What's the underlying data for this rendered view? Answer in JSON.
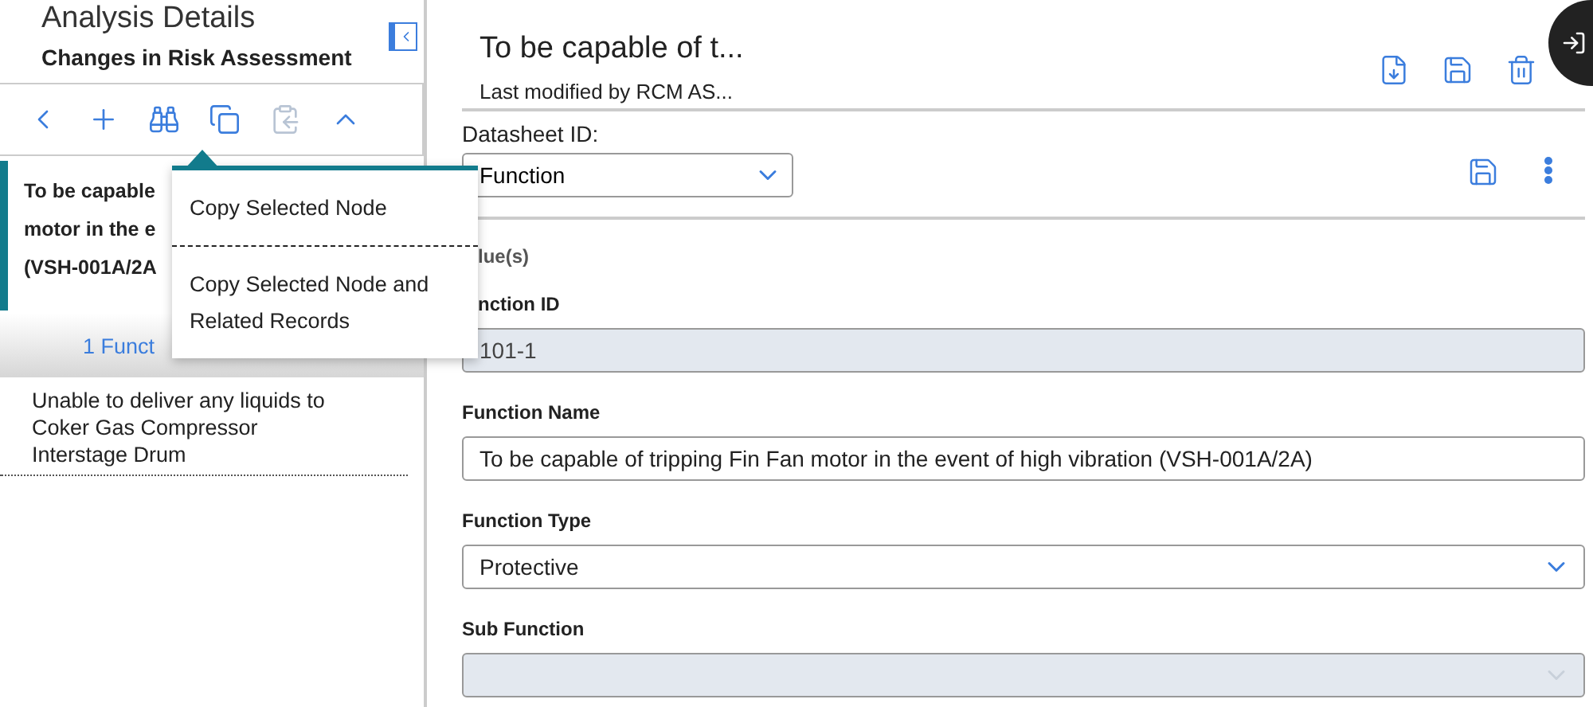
{
  "sidebar": {
    "title": "Analysis Details",
    "subtitle": "Changes in Risk Assessment",
    "toolbar": [
      {
        "kind": "back",
        "disabled": false
      },
      {
        "kind": "add",
        "disabled": false
      },
      {
        "kind": "find",
        "disabled": false
      },
      {
        "kind": "copy",
        "disabled": false
      },
      {
        "kind": "paste",
        "disabled": true
      },
      {
        "kind": "collapse",
        "disabled": false
      }
    ],
    "selected_node": {
      "lines": [
        "To be capable",
        "motor in the e",
        "(VSH-001A/2A"
      ]
    },
    "group_header": "1 Funct",
    "items": [
      {
        "text": "Unable to deliver any liquids to Coker Gas Compressor Interstage Drum"
      }
    ]
  },
  "copy_menu": {
    "items": [
      {
        "label": "Copy Selected Node"
      },
      {
        "label": "Copy Selected Node and Related Records"
      }
    ]
  },
  "record": {
    "title": "To be capable of t...",
    "modified": "Last modified by RCM AS...",
    "datasheet_label": "Datasheet ID:",
    "datasheet_value": "Function",
    "section": "lue(s)",
    "fields": [
      {
        "label": "nction ID",
        "value": "101-1",
        "kind": "text",
        "disabled": true
      },
      {
        "label": "Function Name",
        "value": "To be capable of tripping Fin Fan motor in the event of high vibration (VSH-001A/2A)",
        "kind": "text",
        "disabled": false
      },
      {
        "label": "Function Type",
        "value": "Protective",
        "kind": "select",
        "disabled": false
      },
      {
        "label": "Sub Function",
        "kind": "select",
        "disabled": true
      }
    ]
  }
}
